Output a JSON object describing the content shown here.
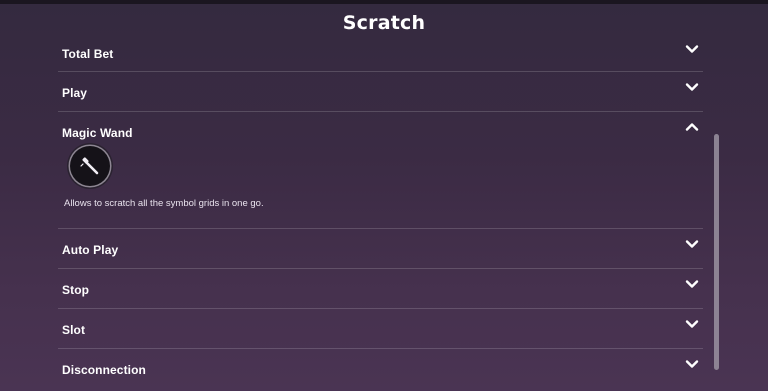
{
  "title": "Scratch",
  "sections": [
    {
      "label": "Total Bet",
      "expanded": false
    },
    {
      "label": "Play",
      "expanded": false
    },
    {
      "label": "Magic Wand",
      "expanded": true,
      "icon": "magic-wand-icon",
      "description": "Allows to scratch all the symbol grids in one go."
    },
    {
      "label": "Auto Play",
      "expanded": false
    },
    {
      "label": "Stop",
      "expanded": false
    },
    {
      "label": "Slot",
      "expanded": false
    },
    {
      "label": "Disconnection",
      "expanded": false
    }
  ],
  "colors": {
    "background_top": "#342a3f",
    "background_bottom": "#4a3453",
    "text": "#ffffff",
    "divider": "rgba(255,255,255,0.16)"
  },
  "icons": {
    "collapsed": "chevron-down-icon",
    "expanded": "chevron-up-icon"
  }
}
